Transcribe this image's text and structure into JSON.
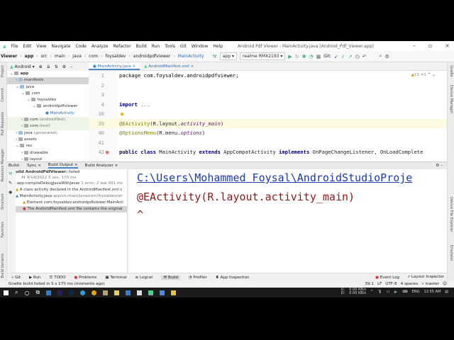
{
  "menu": [
    "File",
    "Edit",
    "View",
    "Navigate",
    "Code",
    "Analyze",
    "Refactor",
    "Build",
    "Run",
    "Tools",
    "Git",
    "Window",
    "Help"
  ],
  "window_title": "Android Pdf Viewer - MainActivity.java [Android_Pdf_Viewer.app]",
  "breadcrumb": [
    "Viewer",
    "app",
    "src",
    "main",
    "java",
    "com",
    "foysaldev",
    "androidpdfviewer",
    "MainActivity"
  ],
  "run_config": "app",
  "device": "realme RMX2193",
  "git_label": "Git:",
  "project_view": "Android",
  "left_strip": [
    "Project",
    "Commit",
    "Pull Requests",
    "Resource Manager",
    "Structure",
    "Favorites",
    "Build Variants"
  ],
  "right_strip": [
    "Gradle",
    "Device Manager",
    "Device File Explorer",
    "Emulator"
  ],
  "tree": [
    {
      "label": "app",
      "depth": 0
    },
    {
      "label": "manifests",
      "depth": 1
    },
    {
      "label": "java",
      "depth": 1
    },
    {
      "label": "com",
      "depth": 2
    },
    {
      "label": "foysaldev",
      "depth": 3
    },
    {
      "label": "androidpdfviewer",
      "depth": 4
    },
    {
      "label": "MainActivity",
      "depth": 5
    },
    {
      "label": "com",
      "suffix": "(androidTest)",
      "depth": 2
    },
    {
      "label": "com",
      "suffix": "(test)",
      "depth": 2
    },
    {
      "label": "java",
      "suffix": "(generated)",
      "depth": 1
    },
    {
      "label": "assets",
      "depth": 1
    },
    {
      "label": "res",
      "depth": 1
    },
    {
      "label": "drawable",
      "depth": 2
    },
    {
      "label": "layout",
      "depth": 2
    }
  ],
  "tabs": [
    "MainActivity.java",
    "AndroidManifest.xml"
  ],
  "inspections": {
    "warnings": "11",
    "errors": "1"
  },
  "code": [
    {
      "ln": "1",
      "text": "package com.foysaldev.androidpdfviewer;"
    },
    {
      "ln": "2",
      "text": ""
    },
    {
      "ln": "3",
      "text": ""
    },
    {
      "ln": "4",
      "text": "import ..."
    },
    {
      "ln": "38",
      "text": ""
    },
    {
      "ln": "39",
      "text": "@EActivity(R.layout.activity_main)"
    },
    {
      "ln": "40",
      "text": "@OptionsMenu(R.menu.options)"
    },
    {
      "ln": "41",
      "text": ""
    },
    {
      "ln": "42",
      "text": "public class MainActivity extends AppCompatActivity implements OnPageChangeListener, OnLoadComplete"
    }
  ],
  "build_tabs": [
    "Build:",
    "Sync",
    "Build Output",
    "Build Analyzer"
  ],
  "build_tree": [
    {
      "text": "uild AndroidPdfViewer:",
      "status": "failed",
      "meta": "At 4/14/2022  5 sec, 170 ms"
    },
    {
      "text": ":app:compileDebugJavaWithJavac",
      "meta": "1 error, 2 war 691 ms"
    },
    {
      "text": "A class activity declared in the AndroidManifest.xml c"
    },
    {
      "text": "MainActivity.java",
      "meta": "app/src/main/java/com/foysaldev/an"
    },
    {
      "text": "Element com.foysaldev.androidpdfviewer.MainActi"
    },
    {
      "text": "The AndroidManifest.xml file contains the original"
    }
  ],
  "console": [
    "C:\\Users\\Mohammed Foysal\\AndroidStudioProje",
    "@EActivity(R.layout.activity_main)",
    "^"
  ],
  "bottom_tools": [
    "Git",
    "Run",
    "TODO",
    "Problems",
    "Terminal",
    "Logcat",
    "Build",
    "Profiler",
    "App Inspection",
    "Event Log",
    "Layout Inspector"
  ],
  "status": {
    "message": "Gradle build failed in 5 s 170 ms (moments ago)",
    "position": "39:1",
    "line_sep": "LF",
    "encoding": "UTF-8",
    "indent": "4 spaces",
    "branch": "master"
  },
  "tray": {
    "upload_label": "U:",
    "download_label": "D:",
    "upload": "0.00 KB/s",
    "download": "0.00 KB/s",
    "lang": "ENG",
    "time": "12:55 AM"
  }
}
